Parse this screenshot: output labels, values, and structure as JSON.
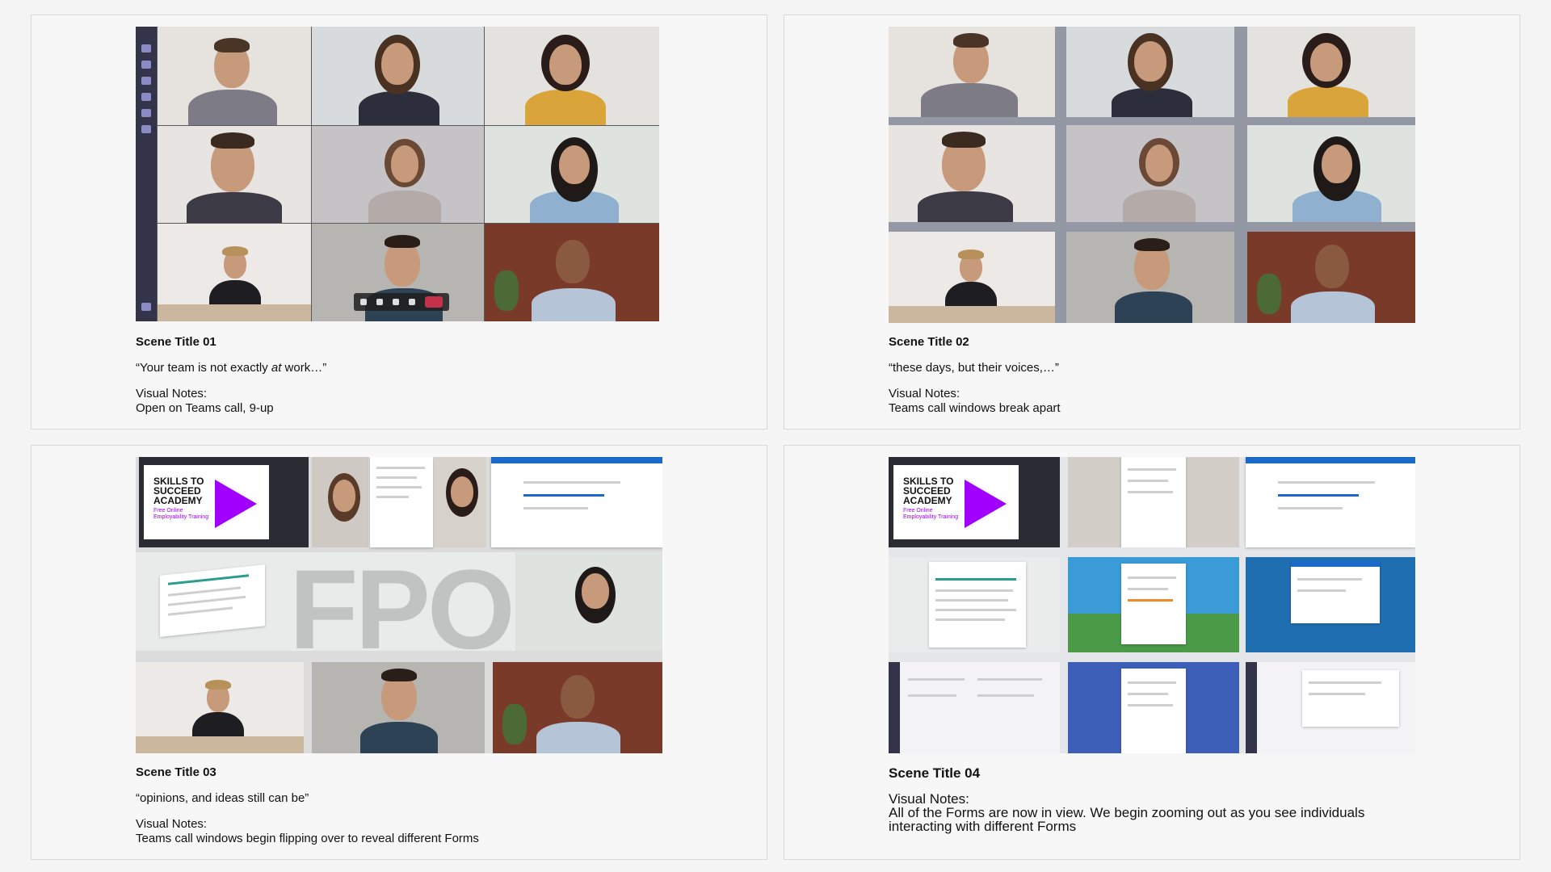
{
  "scenes": [
    {
      "title": "Scene Title 01",
      "quote_before": "“Your team is not exactly ",
      "quote_em": "at",
      "quote_after": " work…”",
      "notes_label": "Visual Notes:",
      "notes_text": "Open on Teams call, 9-up"
    },
    {
      "title": "Scene Title 02",
      "quote": "“these days, but their voices,…”",
      "notes_label": "Visual Notes:",
      "notes_text": "Teams call windows break apart"
    },
    {
      "title": "Scene Title 03",
      "quote": "“opinions, and ideas still can be”",
      "notes_label": "Visual Notes:",
      "notes_text": "Teams call windows begin flipping over to reveal different Forms"
    },
    {
      "title": "Scene Title 04",
      "notes_label": "Visual Notes:",
      "notes_text": "All of the Forms are now in view. We begin zooming out as you see individuals interacting with different Forms"
    }
  ],
  "skills_card": {
    "title": "SKILLS TO\nSUCCEED\nACADEMY",
    "subtitle": "Free Online\nEmployability Training"
  },
  "watermark": "FPO",
  "colors": {
    "accent_purple": "#a100ff",
    "teams_rail": "#33344a",
    "hangup_red": "#c4314b",
    "forms_blue": "#1b6ac9"
  }
}
